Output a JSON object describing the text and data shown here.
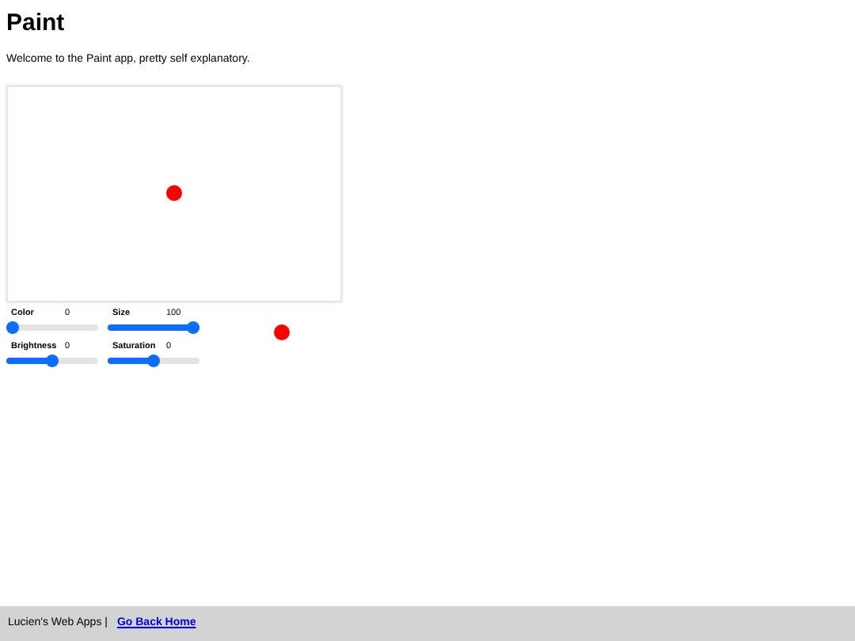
{
  "title": "Paint",
  "intro": "Welcome to the Paint app, pretty self explanatory.",
  "sliders": [
    {
      "label": "Color",
      "reading": "0",
      "level": 0
    },
    {
      "label": "Size",
      "reading": "100",
      "level": 1
    },
    {
      "label": "Brightness",
      "reading": "0",
      "level": 0.5
    },
    {
      "label": "Saturation",
      "reading": "0",
      "level": 0.5
    }
  ],
  "footer": {
    "text": "Lucien's Web Apps |",
    "link": "Go Back Home"
  }
}
